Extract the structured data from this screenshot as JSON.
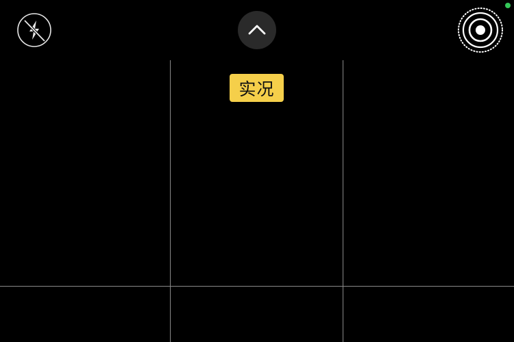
{
  "screen": {
    "name": "camera-viewfinder"
  },
  "colors": {
    "background": "#000000",
    "grid_line": "#8a8a8a",
    "live_badge_bg": "#f5cf4a",
    "camera_in_use_indicator": "#34c759"
  },
  "top_bar": {
    "flash": {
      "icon": "flash-off-icon",
      "state": "off"
    },
    "controls_toggle": {
      "icon": "chevron-up-icon"
    },
    "live_photo": {
      "icon": "live-photo-icon",
      "state": "on"
    }
  },
  "live_badge": {
    "label": "实况"
  },
  "grid": {
    "rows": 3,
    "columns": 3,
    "visible": true
  }
}
